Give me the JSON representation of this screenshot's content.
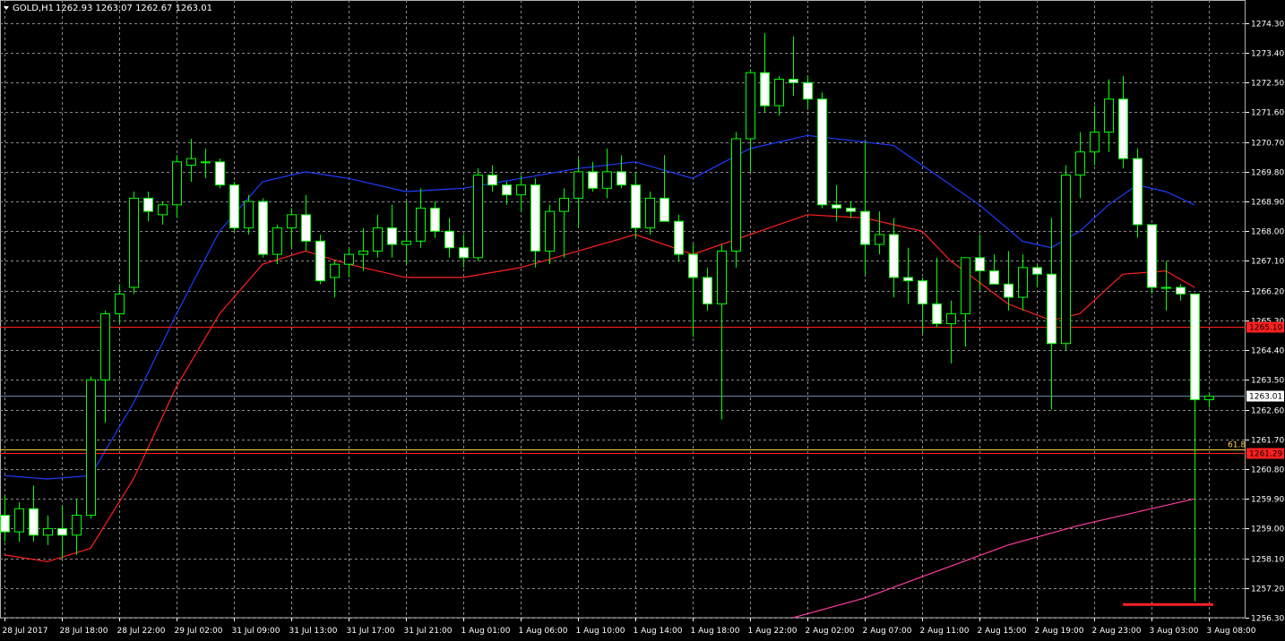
{
  "header": {
    "symbol": "GOLD,H1",
    "ohlc": "1262.93 1263.07 1262.67 1263.01"
  },
  "colors": {
    "background": "#000000",
    "grid": "#8a8a8a",
    "bull_body": "#000000",
    "bear_body": "#ffffff",
    "wick": "#00ff00",
    "ma_fast": "#1e3cff",
    "ma_slow": "#ff2020",
    "ma_long": "#ff3ca0",
    "current_price_line": "#6f86a8",
    "fib_line": "#ffd24a",
    "level_line": "#ff2020",
    "axis_text": "#ffffff"
  },
  "chart_data": {
    "type": "candlestick",
    "ylim": [
      1256.3,
      1275.0
    ],
    "y_ticks": [
      "1274.30",
      "1273.40",
      "1272.50",
      "1271.60",
      "1270.70",
      "1269.80",
      "1268.90",
      "1268.00",
      "1267.10",
      "1266.20",
      "1265.30",
      "1264.40",
      "1263.50",
      "1262.60",
      "1261.70",
      "1260.80",
      "1259.90",
      "1259.00",
      "1258.10",
      "1257.20",
      "1256.30"
    ],
    "x_ticks": [
      {
        "i": 0,
        "label": "28 Jul 2017"
      },
      {
        "i": 4,
        "label": "28 Jul 18:00"
      },
      {
        "i": 8,
        "label": "28 Jul 22:00"
      },
      {
        "i": 12,
        "label": "29 Jul 02:00"
      },
      {
        "i": 16,
        "label": "31 Jul 09:00"
      },
      {
        "i": 20,
        "label": "31 Jul 13:00"
      },
      {
        "i": 24,
        "label": "31 Jul 17:00"
      },
      {
        "i": 28,
        "label": "31 Jul 21:00"
      },
      {
        "i": 32,
        "label": "1 Aug 01:00"
      },
      {
        "i": 36,
        "label": "1 Aug 06:00"
      },
      {
        "i": 40,
        "label": "1 Aug 10:00"
      },
      {
        "i": 44,
        "label": "1 Aug 14:00"
      },
      {
        "i": 48,
        "label": "1 Aug 18:00"
      },
      {
        "i": 52,
        "label": "1 Aug 22:00"
      },
      {
        "i": 56,
        "label": "2 Aug 02:00"
      },
      {
        "i": 60,
        "label": "2 Aug 07:00"
      },
      {
        "i": 64,
        "label": "2 Aug 11:00"
      },
      {
        "i": 68,
        "label": "2 Aug 15:00"
      },
      {
        "i": 72,
        "label": "2 Aug 19:00"
      },
      {
        "i": 76,
        "label": "2 Aug 23:00"
      },
      {
        "i": 80,
        "label": "3 Aug 03:00"
      },
      {
        "i": 84,
        "label": "3 Aug 08:00"
      }
    ],
    "candles": [
      [
        1259.4,
        1260.0,
        1258.6,
        1258.9
      ],
      [
        1258.9,
        1259.8,
        1258.6,
        1259.6
      ],
      [
        1259.6,
        1260.3,
        1258.6,
        1258.8
      ],
      [
        1258.8,
        1259.4,
        1258.5,
        1259.0
      ],
      [
        1259.0,
        1259.7,
        1258.1,
        1258.8
      ],
      [
        1258.8,
        1259.9,
        1258.2,
        1259.4
      ],
      [
        1259.4,
        1263.6,
        1259.3,
        1263.5
      ],
      [
        1263.5,
        1265.6,
        1262.2,
        1265.5
      ],
      [
        1265.5,
        1266.4,
        1265.2,
        1266.1
      ],
      [
        1266.3,
        1269.2,
        1266.1,
        1269.0
      ],
      [
        1269.0,
        1269.2,
        1268.3,
        1268.6
      ],
      [
        1268.5,
        1268.9,
        1268.2,
        1268.8
      ],
      [
        1268.8,
        1270.3,
        1268.4,
        1270.1
      ],
      [
        1270.0,
        1270.8,
        1269.5,
        1270.2
      ],
      [
        1270.1,
        1270.5,
        1269.6,
        1270.1
      ],
      [
        1270.1,
        1270.2,
        1269.3,
        1269.4
      ],
      [
        1269.4,
        1269.5,
        1268.0,
        1268.1
      ],
      [
        1268.1,
        1269.1,
        1267.9,
        1268.9
      ],
      [
        1268.9,
        1269.0,
        1267.2,
        1267.3
      ],
      [
        1267.3,
        1268.2,
        1267.0,
        1268.1
      ],
      [
        1268.1,
        1268.7,
        1267.5,
        1268.5
      ],
      [
        1268.5,
        1269.1,
        1267.4,
        1267.7
      ],
      [
        1267.7,
        1267.9,
        1266.4,
        1266.5
      ],
      [
        1266.6,
        1267.1,
        1266.0,
        1267.0
      ],
      [
        1267.0,
        1267.5,
        1266.6,
        1267.3
      ],
      [
        1267.3,
        1268.1,
        1266.8,
        1267.4
      ],
      [
        1267.4,
        1268.5,
        1267.2,
        1268.1
      ],
      [
        1268.1,
        1268.8,
        1267.2,
        1267.6
      ],
      [
        1267.6,
        1268.9,
        1267.0,
        1267.7
      ],
      [
        1267.7,
        1269.3,
        1267.5,
        1268.7
      ],
      [
        1268.7,
        1268.9,
        1267.8,
        1268.0
      ],
      [
        1268.0,
        1268.4,
        1267.2,
        1267.5
      ],
      [
        1267.5,
        1267.9,
        1266.9,
        1267.2
      ],
      [
        1267.2,
        1269.9,
        1267.1,
        1269.7
      ],
      [
        1269.7,
        1270.0,
        1269.2,
        1269.4
      ],
      [
        1269.4,
        1269.5,
        1268.8,
        1269.1
      ],
      [
        1269.1,
        1269.7,
        1268.6,
        1269.4
      ],
      [
        1269.4,
        1269.6,
        1266.9,
        1267.4
      ],
      [
        1267.4,
        1268.8,
        1267.0,
        1268.6
      ],
      [
        1268.6,
        1269.3,
        1267.2,
        1269.0
      ],
      [
        1269.0,
        1270.2,
        1268.1,
        1269.8
      ],
      [
        1269.8,
        1270.1,
        1269.2,
        1269.3
      ],
      [
        1269.3,
        1270.5,
        1269.0,
        1269.8
      ],
      [
        1269.8,
        1270.3,
        1269.3,
        1269.4
      ],
      [
        1269.4,
        1269.8,
        1267.8,
        1268.1
      ],
      [
        1268.1,
        1269.2,
        1267.9,
        1269.0
      ],
      [
        1269.0,
        1270.3,
        1268.5,
        1268.3
      ],
      [
        1268.3,
        1268.5,
        1267.1,
        1267.3
      ],
      [
        1267.3,
        1267.6,
        1264.8,
        1266.6
      ],
      [
        1266.6,
        1266.9,
        1265.6,
        1265.8
      ],
      [
        1265.8,
        1267.6,
        1262.3,
        1267.4
      ],
      [
        1267.4,
        1271.0,
        1266.9,
        1270.8
      ],
      [
        1270.8,
        1272.9,
        1269.8,
        1272.8
      ],
      [
        1272.8,
        1274.0,
        1271.6,
        1271.8
      ],
      [
        1271.8,
        1272.7,
        1271.5,
        1272.6
      ],
      [
        1272.6,
        1273.9,
        1272.1,
        1272.5
      ],
      [
        1272.5,
        1272.7,
        1271.7,
        1272.0
      ],
      [
        1272.0,
        1272.2,
        1268.7,
        1268.8
      ],
      [
        1268.8,
        1269.4,
        1268.3,
        1268.7
      ],
      [
        1268.7,
        1268.9,
        1268.4,
        1268.6
      ],
      [
        1268.6,
        1270.7,
        1266.7,
        1267.6
      ],
      [
        1267.6,
        1268.6,
        1267.3,
        1267.9
      ],
      [
        1267.9,
        1268.4,
        1266.0,
        1266.6
      ],
      [
        1266.6,
        1267.5,
        1265.8,
        1266.5
      ],
      [
        1266.5,
        1266.6,
        1264.9,
        1265.8
      ],
      [
        1265.8,
        1267.2,
        1265.1,
        1265.2
      ],
      [
        1265.2,
        1265.9,
        1264.0,
        1265.5
      ],
      [
        1265.5,
        1266.7,
        1264.5,
        1267.2
      ],
      [
        1267.2,
        1267.9,
        1266.2,
        1266.8
      ],
      [
        1266.8,
        1267.3,
        1266.4,
        1266.4
      ],
      [
        1266.4,
        1267.4,
        1265.6,
        1266.0
      ],
      [
        1266.0,
        1267.3,
        1265.6,
        1266.9
      ],
      [
        1266.9,
        1267.0,
        1266.3,
        1266.7
      ],
      [
        1266.7,
        1268.4,
        1262.6,
        1264.6
      ],
      [
        1264.6,
        1270.0,
        1264.4,
        1269.7
      ],
      [
        1269.7,
        1271.0,
        1269.0,
        1270.4
      ],
      [
        1270.4,
        1271.8,
        1270.0,
        1271.0
      ],
      [
        1271.0,
        1272.6,
        1270.4,
        1272.0
      ],
      [
        1272.0,
        1272.7,
        1269.9,
        1270.2
      ],
      [
        1270.2,
        1270.5,
        1267.8,
        1268.2
      ],
      [
        1268.2,
        1268.2,
        1266.1,
        1266.3
      ],
      [
        1266.3,
        1267.1,
        1265.6,
        1266.3
      ],
      [
        1266.3,
        1266.4,
        1265.9,
        1266.1
      ],
      [
        1266.1,
        1266.1,
        1256.8,
        1262.9
      ],
      [
        1262.9,
        1263.07,
        1262.67,
        1263.01
      ]
    ],
    "ma_fast": [
      [
        0,
        1260.6
      ],
      [
        3,
        1260.5
      ],
      [
        6,
        1260.6
      ],
      [
        9,
        1262.8
      ],
      [
        12,
        1265.5
      ],
      [
        15,
        1268.0
      ],
      [
        18,
        1269.5
      ],
      [
        21,
        1269.8
      ],
      [
        24,
        1269.6
      ],
      [
        28,
        1269.2
      ],
      [
        32,
        1269.3
      ],
      [
        36,
        1269.6
      ],
      [
        40,
        1269.9
      ],
      [
        44,
        1270.1
      ],
      [
        48,
        1269.6
      ],
      [
        52,
        1270.5
      ],
      [
        56,
        1270.9
      ],
      [
        60,
        1270.7
      ],
      [
        62,
        1270.6
      ],
      [
        64,
        1270.0
      ],
      [
        68,
        1268.8
      ],
      [
        71,
        1267.7
      ],
      [
        73,
        1267.5
      ],
      [
        75,
        1268.0
      ],
      [
        77,
        1268.8
      ],
      [
        79,
        1269.4
      ],
      [
        81,
        1269.2
      ],
      [
        83,
        1268.8
      ]
    ],
    "ma_slow": [
      [
        0,
        1258.2
      ],
      [
        3,
        1258.0
      ],
      [
        6,
        1258.4
      ],
      [
        9,
        1260.5
      ],
      [
        12,
        1263.3
      ],
      [
        15,
        1265.5
      ],
      [
        18,
        1267.0
      ],
      [
        21,
        1267.4
      ],
      [
        24,
        1267.0
      ],
      [
        28,
        1266.6
      ],
      [
        32,
        1266.6
      ],
      [
        36,
        1266.9
      ],
      [
        40,
        1267.4
      ],
      [
        44,
        1267.9
      ],
      [
        48,
        1267.3
      ],
      [
        52,
        1267.9
      ],
      [
        56,
        1268.5
      ],
      [
        60,
        1268.4
      ],
      [
        64,
        1268.0
      ],
      [
        66,
        1267.1
      ],
      [
        70,
        1265.8
      ],
      [
        73,
        1265.3
      ],
      [
        75,
        1265.5
      ],
      [
        78,
        1266.7
      ],
      [
        81,
        1266.8
      ],
      [
        83,
        1266.3
      ]
    ],
    "ma_long": [
      [
        55,
        1256.3
      ],
      [
        60,
        1256.9
      ],
      [
        65,
        1257.7
      ],
      [
        70,
        1258.5
      ],
      [
        75,
        1259.1
      ],
      [
        80,
        1259.6
      ],
      [
        83,
        1259.9
      ]
    ],
    "levels": [
      {
        "name": "upper-level",
        "value": 1265.1,
        "label": "1265.10"
      },
      {
        "name": "current-price",
        "value": 1263.01,
        "label": "1263.01"
      },
      {
        "name": "fib",
        "value": 1261.4,
        "label": "61.8"
      },
      {
        "name": "lower-level",
        "value": 1261.29,
        "label": "1261.29"
      }
    ],
    "target_segment": {
      "from_i": 78,
      "to_i": 84,
      "value": 1256.7
    }
  }
}
